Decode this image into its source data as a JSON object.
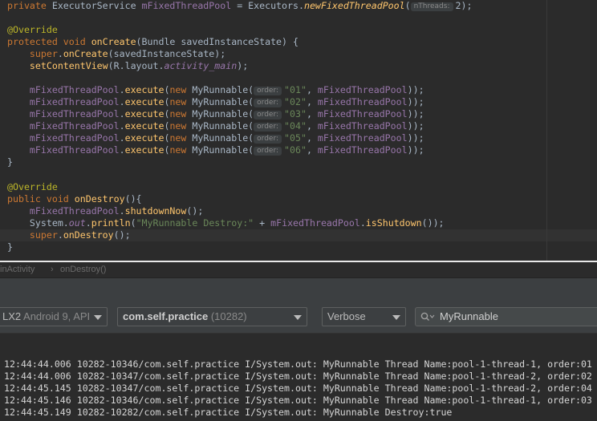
{
  "editor": {
    "lines": [
      {
        "t": 0,
        "segs": [
          [
            "kw",
            "private "
          ],
          [
            "",
            "ExecutorService "
          ],
          [
            "fld",
            "mFixedThreadPool"
          ],
          [
            "",
            " = Executors."
          ],
          [
            "fn it",
            "newFixedThreadPool"
          ],
          [
            "",
            "("
          ],
          [
            "hint",
            "nThreads:"
          ],
          [
            "",
            "2);"
          ]
        ]
      },
      {
        "t": 30,
        "segs": [
          [
            "ann",
            "@Override"
          ]
        ]
      },
      {
        "t": 45,
        "segs": [
          [
            "kw",
            "protected void "
          ],
          [
            "fn",
            "onCreate"
          ],
          [
            "",
            "(Bundle savedInstanceState) {"
          ]
        ]
      },
      {
        "t": 60,
        "segs": [
          [
            "",
            "    "
          ],
          [
            "kw",
            "super"
          ],
          [
            "",
            "."
          ],
          [
            "fn",
            "onCreate"
          ],
          [
            "",
            "(savedInstanceState);"
          ]
        ]
      },
      {
        "t": 75,
        "segs": [
          [
            "",
            "    "
          ],
          [
            "fn",
            "setContentView"
          ],
          [
            "",
            "(R.layout."
          ],
          [
            "fld it",
            "activity_main"
          ],
          [
            "",
            ");"
          ]
        ]
      },
      {
        "t": 105,
        "segs": [
          [
            "",
            "    "
          ],
          [
            "fld",
            "mFixedThreadPool"
          ],
          [
            "",
            "."
          ],
          [
            "fn",
            "execute"
          ],
          [
            "",
            "("
          ],
          [
            "kw",
            "new "
          ],
          [
            "",
            "MyRunnable("
          ],
          [
            "hint",
            "order:"
          ],
          [
            "str",
            "\"01\""
          ],
          [
            "",
            ", "
          ],
          [
            "fld",
            "mFixedThreadPool"
          ],
          [
            "",
            "));"
          ]
        ]
      },
      {
        "t": 120,
        "segs": [
          [
            "",
            "    "
          ],
          [
            "fld",
            "mFixedThreadPool"
          ],
          [
            "",
            "."
          ],
          [
            "fn",
            "execute"
          ],
          [
            "",
            "("
          ],
          [
            "kw",
            "new "
          ],
          [
            "",
            "MyRunnable("
          ],
          [
            "hint",
            "order:"
          ],
          [
            "str",
            "\"02\""
          ],
          [
            "",
            ", "
          ],
          [
            "fld",
            "mFixedThreadPool"
          ],
          [
            "",
            "));"
          ]
        ]
      },
      {
        "t": 135,
        "segs": [
          [
            "",
            "    "
          ],
          [
            "fld",
            "mFixedThreadPool"
          ],
          [
            "",
            "."
          ],
          [
            "fn",
            "execute"
          ],
          [
            "",
            "("
          ],
          [
            "kw",
            "new "
          ],
          [
            "",
            "MyRunnable("
          ],
          [
            "hint",
            "order:"
          ],
          [
            "str",
            "\"03\""
          ],
          [
            "",
            ", "
          ],
          [
            "fld",
            "mFixedThreadPool"
          ],
          [
            "",
            "));"
          ]
        ]
      },
      {
        "t": 150,
        "segs": [
          [
            "",
            "    "
          ],
          [
            "fld",
            "mFixedThreadPool"
          ],
          [
            "",
            "."
          ],
          [
            "fn",
            "execute"
          ],
          [
            "",
            "("
          ],
          [
            "kw",
            "new "
          ],
          [
            "",
            "MyRunnable("
          ],
          [
            "hint",
            "order:"
          ],
          [
            "str",
            "\"04\""
          ],
          [
            "",
            ", "
          ],
          [
            "fld",
            "mFixedThreadPool"
          ],
          [
            "",
            "));"
          ]
        ]
      },
      {
        "t": 165,
        "segs": [
          [
            "",
            "    "
          ],
          [
            "fld",
            "mFixedThreadPool"
          ],
          [
            "",
            "."
          ],
          [
            "fn",
            "execute"
          ],
          [
            "",
            "("
          ],
          [
            "kw",
            "new "
          ],
          [
            "",
            "MyRunnable("
          ],
          [
            "hint",
            "order:"
          ],
          [
            "str",
            "\"05\""
          ],
          [
            "",
            ", "
          ],
          [
            "fld",
            "mFixedThreadPool"
          ],
          [
            "",
            "));"
          ]
        ]
      },
      {
        "t": 180,
        "segs": [
          [
            "",
            "    "
          ],
          [
            "fld",
            "mFixedThreadPool"
          ],
          [
            "",
            "."
          ],
          [
            "fn",
            "execute"
          ],
          [
            "",
            "("
          ],
          [
            "kw",
            "new "
          ],
          [
            "",
            "MyRunnable("
          ],
          [
            "hint",
            "order:"
          ],
          [
            "str",
            "\"06\""
          ],
          [
            "",
            ", "
          ],
          [
            "fld",
            "mFixedThreadPool"
          ],
          [
            "",
            "));"
          ]
        ]
      },
      {
        "t": 195,
        "segs": [
          [
            "",
            "}"
          ]
        ]
      },
      {
        "t": 226,
        "segs": [
          [
            "ann",
            "@Override"
          ]
        ]
      },
      {
        "t": 241,
        "segs": [
          [
            "kw",
            "public void "
          ],
          [
            "fn",
            "onDestroy"
          ],
          [
            "",
            "(){"
          ]
        ]
      },
      {
        "t": 256,
        "segs": [
          [
            "",
            "    "
          ],
          [
            "fld",
            "mFixedThreadPool"
          ],
          [
            "",
            "."
          ],
          [
            "fn",
            "shutdownNow"
          ],
          [
            "",
            "();"
          ]
        ]
      },
      {
        "t": 271,
        "segs": [
          [
            "",
            "    System."
          ],
          [
            "fld it",
            "out"
          ],
          [
            "",
            "."
          ],
          [
            "fn",
            "println"
          ],
          [
            "",
            "("
          ],
          [
            "str",
            "\"MyRunnable Destroy:\""
          ],
          [
            "",
            " + "
          ],
          [
            "fld",
            "mFixedThreadPool"
          ],
          [
            "",
            "."
          ],
          [
            "fn",
            "isShutdown"
          ],
          [
            "",
            "());"
          ]
        ]
      },
      {
        "t": 286,
        "segs": [
          [
            "",
            "    "
          ],
          [
            "kw",
            "super"
          ],
          [
            "",
            "."
          ],
          [
            "fn",
            "onDestroy"
          ],
          [
            "",
            "();"
          ]
        ]
      },
      {
        "t": 301,
        "segs": [
          [
            "",
            "}"
          ]
        ]
      }
    ]
  },
  "breadcrumb": {
    "class_name": "inActivity",
    "separator": "›",
    "method_name": "onDestroy()"
  },
  "logcat": {
    "device_bold": "LX2",
    "device_rest": " Android 9, API",
    "process_bold": "com.self.practice",
    "process_pid": " (10282)",
    "level": "Verbose",
    "search_text": "MyRunnable",
    "lines": [
      "12:44:44.006 10282-10346/com.self.practice I/System.out: MyRunnable Thread Name:pool-1-thread-1, order:01",
      "12:44:44.006 10282-10347/com.self.practice I/System.out: MyRunnable Thread Name:pool-1-thread-2, order:02",
      "12:44:45.145 10282-10347/com.self.practice I/System.out: MyRunnable Thread Name:pool-1-thread-2, order:04",
      "12:44:45.146 10282-10346/com.self.practice I/System.out: MyRunnable Thread Name:pool-1-thread-1, order:03",
      "12:44:45.149 10282-10282/com.self.practice I/System.out: MyRunnable Destroy:true"
    ]
  }
}
